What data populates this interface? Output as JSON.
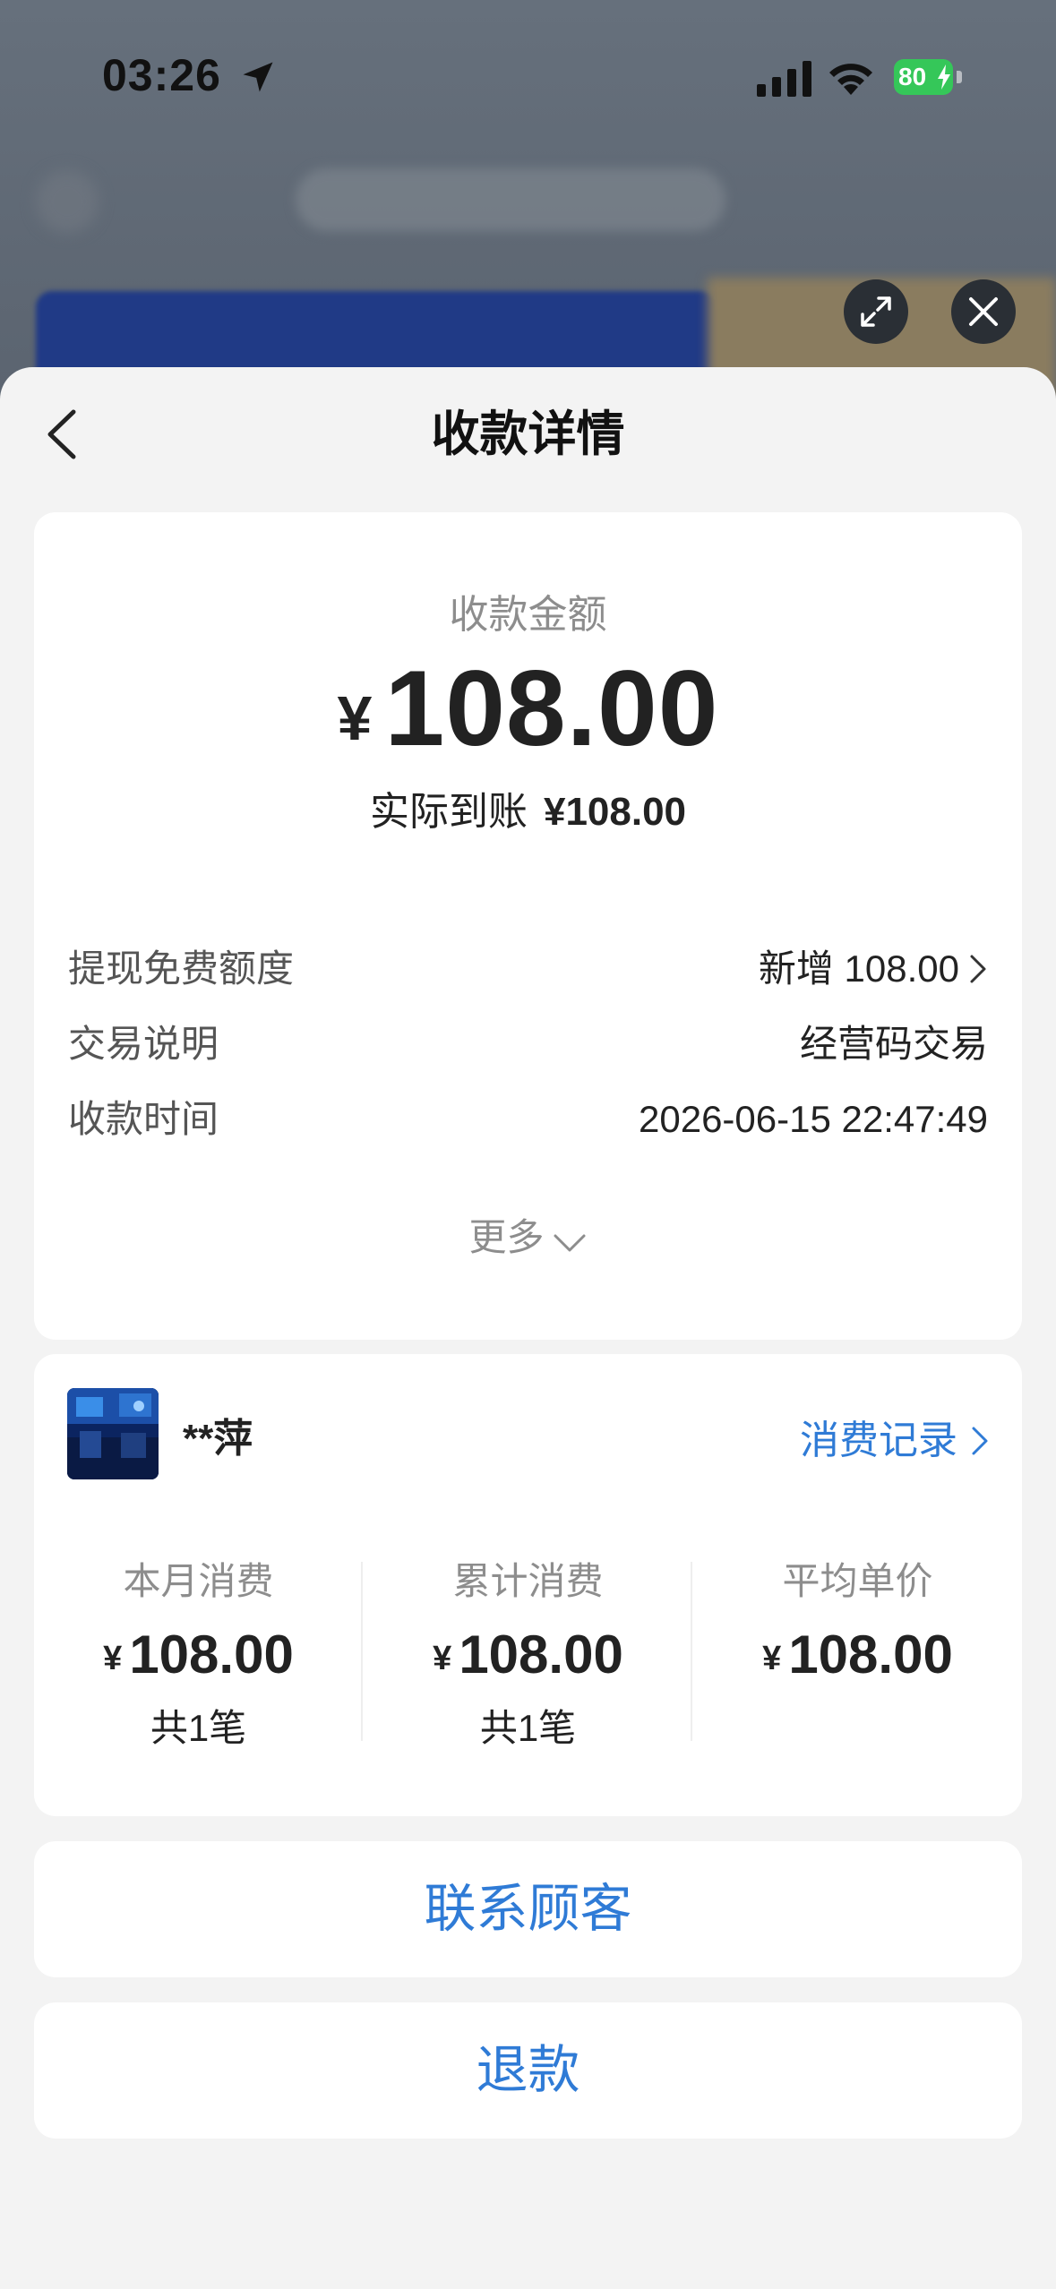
{
  "status_bar": {
    "time": "03:26",
    "battery": "80"
  },
  "sheet": {
    "title": "收款详情"
  },
  "amount": {
    "label": "收款金额",
    "currency": "¥",
    "value": "108.00",
    "actual_label": "实际到账",
    "actual_value": "¥108.00"
  },
  "details": [
    {
      "key": "提现免费额度",
      "value": "新增 108.00"
    },
    {
      "key": "交易说明",
      "value": "经营码交易"
    },
    {
      "key": "收款时间",
      "value": "2026-06-15 22:47:49"
    }
  ],
  "more_label": "更多",
  "customer": {
    "name": "**萍",
    "records_link": "消费记录",
    "stats": [
      {
        "label": "本月消费",
        "currency": "¥",
        "value": "108.00",
        "count": "共1笔"
      },
      {
        "label": "累计消费",
        "currency": "¥",
        "value": "108.00",
        "count": "共1笔"
      },
      {
        "label": "平均单价",
        "currency": "¥",
        "value": "108.00"
      }
    ]
  },
  "actions": {
    "contact": "联系顾客",
    "refund": "退款"
  },
  "colors": {
    "accent": "#2f7bd6",
    "battery": "#35c759",
    "background": "#f3f3f3"
  }
}
